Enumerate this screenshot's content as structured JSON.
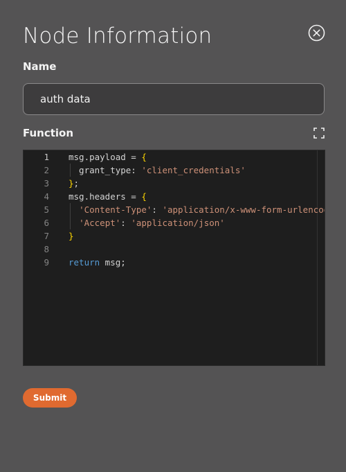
{
  "dialog": {
    "title": "Node Information"
  },
  "name_field": {
    "label": "Name",
    "value": "auth data"
  },
  "function_field": {
    "label": "Function"
  },
  "editor": {
    "active_line": 1,
    "lines": [
      {
        "num": "1",
        "tokens": [
          {
            "t": "msg.payload = "
          },
          {
            "t": "{",
            "c": "tok-brace"
          }
        ]
      },
      {
        "num": "2",
        "indent": true,
        "tokens": [
          {
            "t": "  grant_type: "
          },
          {
            "t": "'client_credentials'",
            "c": "tok-str"
          }
        ]
      },
      {
        "num": "3",
        "tokens": [
          {
            "t": "}",
            "c": "tok-brace"
          },
          {
            "t": ";"
          }
        ]
      },
      {
        "num": "4",
        "tokens": [
          {
            "t": "msg.headers = "
          },
          {
            "t": "{",
            "c": "tok-brace"
          }
        ]
      },
      {
        "num": "5",
        "indent": true,
        "tokens": [
          {
            "t": "  "
          },
          {
            "t": "'Content-Type'",
            "c": "tok-str"
          },
          {
            "t": ": "
          },
          {
            "t": "'application/x-www-form-urlencoded'",
            "c": "tok-str"
          },
          {
            "t": ","
          }
        ]
      },
      {
        "num": "6",
        "indent": true,
        "tokens": [
          {
            "t": "  "
          },
          {
            "t": "'Accept'",
            "c": "tok-str"
          },
          {
            "t": ": "
          },
          {
            "t": "'application/json'",
            "c": "tok-str"
          }
        ]
      },
      {
        "num": "7",
        "tokens": [
          {
            "t": "}",
            "c": "tok-brace"
          }
        ]
      },
      {
        "num": "8",
        "tokens": []
      },
      {
        "num": "9",
        "tokens": [
          {
            "t": "return",
            "c": "tok-kw"
          },
          {
            "t": " msg;"
          }
        ]
      }
    ]
  },
  "actions": {
    "submit_label": "Submit"
  },
  "colors": {
    "background": "#545354",
    "accent": "#e06a30",
    "editor_bg": "#1e1e1e"
  },
  "icons": {
    "close": "close-circle-icon",
    "expand": "expand-icon"
  }
}
